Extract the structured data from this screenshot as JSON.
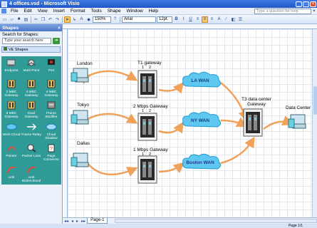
{
  "window": {
    "title": "4 offices.vsd - Microsoft Visio"
  },
  "menu": {
    "items": [
      "File",
      "Edit",
      "View",
      "Insert",
      "Format",
      "Tools",
      "Shape",
      "Window",
      "Help"
    ],
    "help_placeholder": "Type a question for help"
  },
  "toolbar": {
    "zoom": "150%",
    "font": "Arial",
    "font_size": "12pt."
  },
  "shapes_panel": {
    "title": "Shapes",
    "search_label": "Search for Shapes:",
    "search_placeholder": "Type your search here",
    "stencil": "VE Shapes",
    "items": [
      {
        "label": "Endpoint",
        "icon": "endpoint-icon"
      },
      {
        "label": "Multi-Point",
        "icon": "multipoint-icon"
      },
      {
        "label": "Port",
        "icon": "port-icon"
      },
      {
        "label": "2 MBC Gateway",
        "icon": "gateway-icon"
      },
      {
        "label": "4 MBC Gateway",
        "icon": "gateway-icon"
      },
      {
        "label": "4 MBC Gateway",
        "icon": "gateway-icon"
      },
      {
        "label": "8 MBC Gateway",
        "icon": "gateway-icon"
      },
      {
        "label": "Dual Gateway",
        "icon": "gateway-icon"
      },
      {
        "label": "Frame Modifier",
        "icon": "frame-icon"
      },
      {
        "label": "WAN Cloud",
        "icon": "cloud-icon"
      },
      {
        "label": "Frame Relay",
        "icon": "relay-icon"
      },
      {
        "label": "Cloud Shadow",
        "icon": "cloud-icon"
      },
      {
        "label": "Pointer",
        "icon": "pointer-icon"
      },
      {
        "label": "Packet Loss",
        "icon": "magnifier-icon"
      },
      {
        "label": "Page Connector",
        "icon": "connector-icon"
      },
      {
        "label": "Link",
        "icon": "link-icon"
      },
      {
        "label": "Link Bidirectional",
        "icon": "link-icon"
      }
    ]
  },
  "diagram": {
    "offices": [
      "London",
      "Tokyo",
      "Dallas"
    ],
    "gateways": [
      "T1 gateway",
      "2 Mbps Gateway",
      "1 Mbps Gateway"
    ],
    "port_labels": [
      "1",
      "2"
    ],
    "clouds": [
      "LA WAN",
      "NY WAN",
      "Boston WAN"
    ],
    "datacenter_gateway": "T3 data center Gateway",
    "datacenter": "Data Center",
    "colors": {
      "link": "#f0a15a",
      "cloud": "#5ec8f0",
      "cloud_text": "#1f3a8a",
      "server": "#2a2a2a"
    }
  },
  "bottom": {
    "page_tab": "Page-1",
    "status": "Page 1/1"
  }
}
